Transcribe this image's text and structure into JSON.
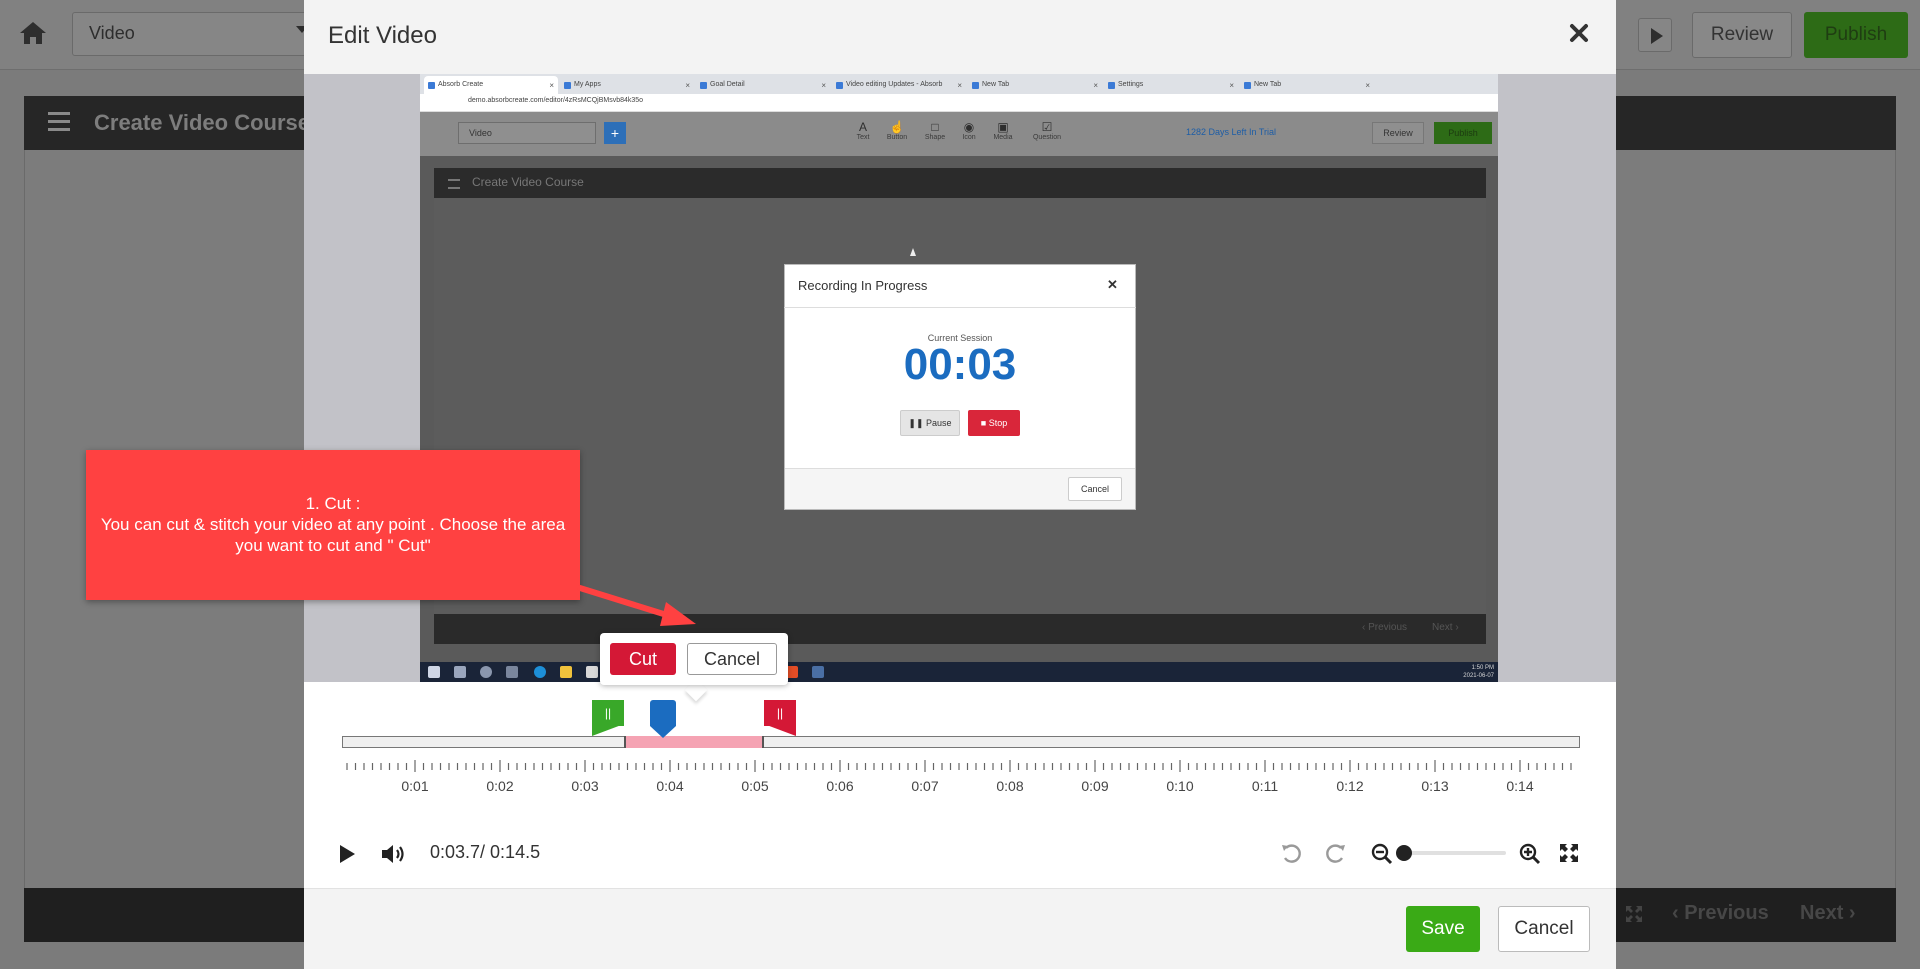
{
  "background_editor": {
    "select_value": "Video",
    "review_label": "Review",
    "publish_label": "Publish",
    "course_title": "Create Video Course",
    "previous_label": "Previous",
    "next_label": "Next"
  },
  "modal": {
    "title": "Edit Video",
    "save_label": "Save",
    "cancel_label": "Cancel"
  },
  "video_frame": {
    "browser_tabs": [
      "Absorb Create",
      "My Apps",
      "Goal Detail",
      "Video editing Updates - Absorb",
      "New Tab",
      "Settings",
      "New Tab"
    ],
    "url": "demo.absorbcreate.com/editor/4zRsMCQjBMsvb84k35o",
    "app_select_value": "Video",
    "tools": [
      "Text",
      "Button",
      "Shape",
      "Icon",
      "Media",
      "Question"
    ],
    "trial_text": "1282 Days Left In Trial",
    "review_label": "Review",
    "publish_label": "Publish",
    "course_title": "Create Video Course",
    "previous_label": "Previous",
    "next_label": "Next",
    "clock_time": "1:50 PM",
    "clock_date": "2021-06-07",
    "recording_dialog": {
      "title": "Recording In Progress",
      "session_label": "Current Session",
      "timer": "00:03",
      "pause_label": "Pause",
      "stop_label": "Stop",
      "cancel_label": "Cancel"
    }
  },
  "callout": {
    "line1": "1. Cut :",
    "line2": "You can cut & stitch your video at any point . Choose the area you want to cut and \" Cut\""
  },
  "cut_popup": {
    "cut_label": "Cut",
    "cancel_label": "Cancel"
  },
  "timeline": {
    "start_handle_glyph": "||",
    "end_handle_glyph": "||",
    "tick_labels": [
      "0:01",
      "0:02",
      "0:03",
      "0:04",
      "0:05",
      "0:06",
      "0:07",
      "0:08",
      "0:09",
      "0:10",
      "0:11",
      "0:12",
      "0:13",
      "0:14"
    ],
    "current_time": "0:03.7",
    "duration": "0:14.5",
    "time_display": "0:03.7/ 0:14.5",
    "selection_start_seconds": 3.3,
    "selection_end_seconds": 4.95,
    "playhead_seconds": 3.75,
    "zoom_level_fraction": 0.0
  },
  "colors": {
    "save_green": "#3aaa16",
    "cut_red": "#d41836",
    "callout_red": "#ff4141",
    "playhead_blue": "#1b6cc0",
    "start_handle_green": "#39a829"
  },
  "icons": [
    "home-icon",
    "play-icon",
    "close-icon",
    "volume-icon",
    "undo-icon",
    "redo-icon",
    "zoom-out-icon",
    "zoom-in-icon",
    "fullscreen-icon",
    "expand-icon",
    "menu-icon"
  ]
}
